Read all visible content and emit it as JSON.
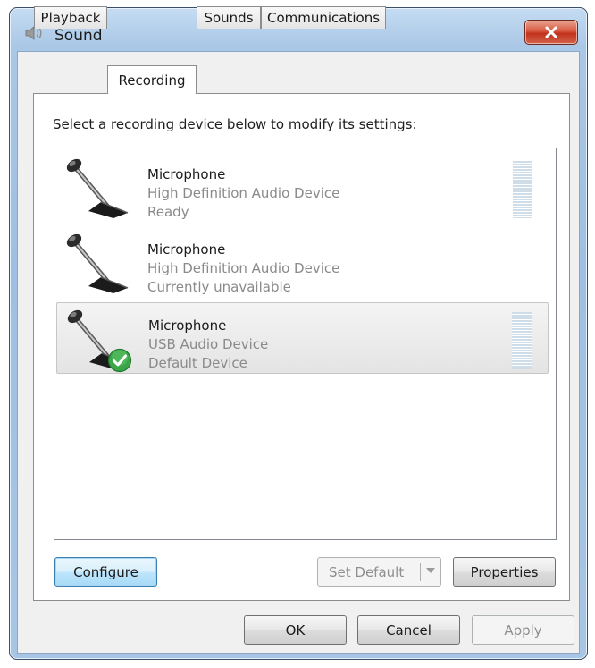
{
  "window": {
    "title": "Sound",
    "close_label": "x"
  },
  "tabs": [
    {
      "label": "Playback",
      "active": false
    },
    {
      "label": "Recording",
      "active": true
    },
    {
      "label": "Sounds",
      "active": false
    },
    {
      "label": "Communications",
      "active": false
    }
  ],
  "instruction": "Select a recording device below to modify its settings:",
  "devices": [
    {
      "name": "Microphone",
      "description": "High Definition Audio Device",
      "status": "Ready",
      "selected": false,
      "default": false,
      "level_meter": true,
      "icon": "microphone-icon"
    },
    {
      "name": "Microphone",
      "description": "High Definition Audio Device",
      "status": "Currently unavailable",
      "selected": false,
      "default": false,
      "level_meter": false,
      "icon": "microphone-icon"
    },
    {
      "name": "Microphone",
      "description": "USB Audio Device",
      "status": "Default Device",
      "selected": true,
      "default": true,
      "level_meter": true,
      "icon": "microphone-icon"
    }
  ],
  "buttons": {
    "configure": "Configure",
    "set_default": "Set Default",
    "properties": "Properties",
    "ok": "OK",
    "cancel": "Cancel",
    "apply": "Apply"
  },
  "colors": {
    "default_check": "#3aa647",
    "close_button": "#c8412a",
    "focus_border": "#3c7fb1"
  }
}
